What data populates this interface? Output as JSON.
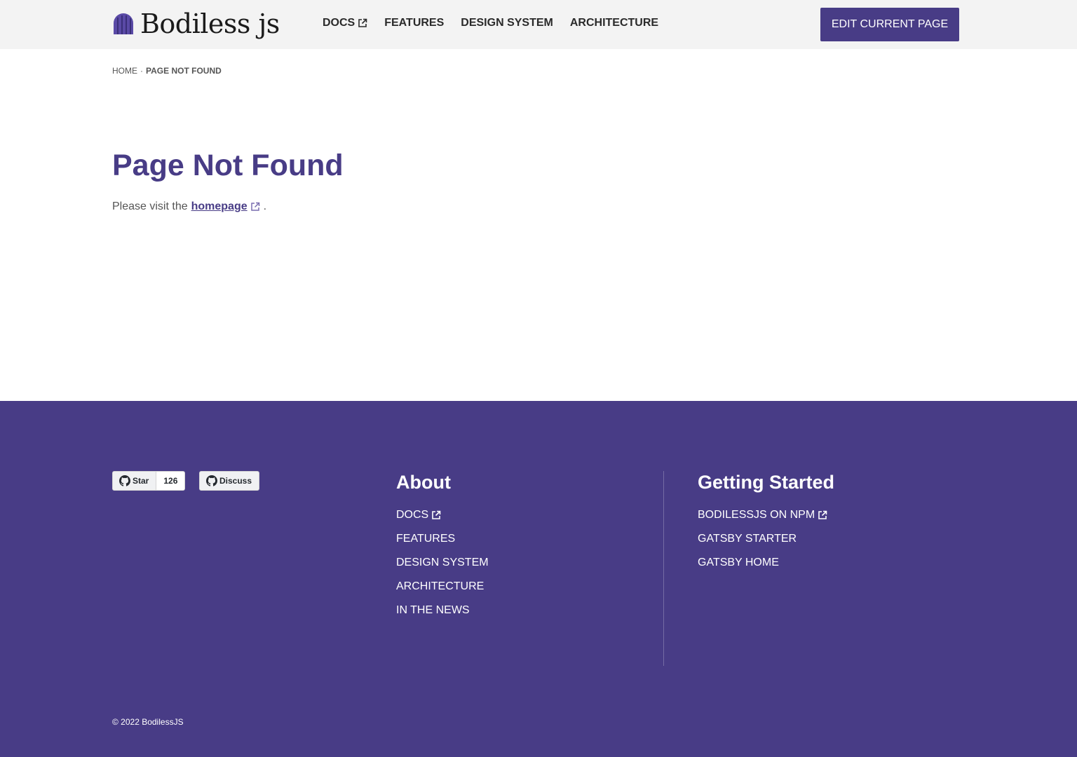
{
  "header": {
    "logo_text": "Bodiless js",
    "nav": [
      {
        "label": "DOCS",
        "external": true
      },
      {
        "label": "FEATURES",
        "external": false
      },
      {
        "label": "DESIGN SYSTEM",
        "external": false
      },
      {
        "label": "ARCHITECTURE",
        "external": false
      }
    ],
    "edit_button": "EDIT CURRENT PAGE"
  },
  "breadcrumb": {
    "home": "HOME",
    "separator": "·",
    "current": "PAGE NOT FOUND"
  },
  "main": {
    "title": "Page Not Found",
    "text_before": "Please visit the",
    "link_text": "homepage",
    "text_after": "."
  },
  "footer": {
    "github_star_label": "Star",
    "github_star_count": "126",
    "github_discuss_label": "Discuss",
    "about": {
      "title": "About",
      "links": [
        {
          "label": "DOCS",
          "external": true
        },
        {
          "label": "FEATURES",
          "external": false
        },
        {
          "label": "DESIGN SYSTEM",
          "external": false
        },
        {
          "label": "ARCHITECTURE",
          "external": false
        },
        {
          "label": "IN THE NEWS",
          "external": false
        }
      ]
    },
    "getting_started": {
      "title": "Getting Started",
      "links": [
        {
          "label": "BODILESSJS ON NPM",
          "external": true
        },
        {
          "label": "GATSBY STARTER",
          "external": false
        },
        {
          "label": "GATSBY HOME",
          "external": false
        }
      ]
    },
    "copyright": "©  2022 BodilessJS"
  },
  "colors": {
    "brand_purple": "#483c86",
    "header_bg": "#f3f3f3"
  },
  "icons": {
    "external": "external-link-icon",
    "github": "github-icon",
    "logo": "bodiless-logo-icon"
  }
}
